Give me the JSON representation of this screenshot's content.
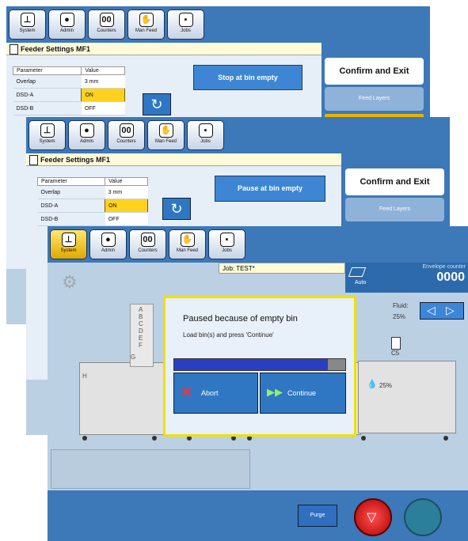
{
  "toolbar": {
    "system": "System",
    "admin": "Admin",
    "counters": "Counters",
    "man_feed": "Man Feed",
    "jobs": "Jobs"
  },
  "window1": {
    "title": "Feeder Settings MF1",
    "table_header": {
      "parameter": "Parameter",
      "value": "Value"
    },
    "rows": [
      {
        "param": "Overlap",
        "value": "3 mm"
      },
      {
        "param": "DSD-A",
        "value": "ON"
      },
      {
        "param": "DSD-B",
        "value": "OFF"
      }
    ],
    "action_button": "Stop at bin empty",
    "confirm": "Confirm and Exit",
    "feed_layers": "Feed Layers"
  },
  "window2": {
    "title": "Feeder Settings MF1",
    "table_header": {
      "parameter": "Parameter",
      "value": "Value"
    },
    "rows": [
      {
        "param": "Overlap",
        "value": "3 mm"
      },
      {
        "param": "DSD-A",
        "value": "ON"
      },
      {
        "param": "DSD-B",
        "value": "OFF"
      }
    ],
    "action_button": "Pause at bin empty",
    "confirm": "Confirm and Exit",
    "feed_layers": "Feed Layers"
  },
  "window3": {
    "job": "Job: TEST*",
    "auto": "Auto",
    "envelope_counter_label": "Envelope counter",
    "envelope_counter": "0000",
    "fluid_label": "Fluid:",
    "fluid_value": "25%",
    "ink_level": "25%",
    "envelope_size": "C5",
    "bin_letters": [
      "A",
      "B",
      "C",
      "D",
      "E",
      "F",
      "G",
      "H"
    ],
    "dialog": {
      "title": "Paused because of empty bin",
      "message": "Load bin(s) and press 'Continue'",
      "abort": "Abort",
      "continue": "Continue",
      "progress": 0.9
    },
    "purge": "Purge"
  }
}
